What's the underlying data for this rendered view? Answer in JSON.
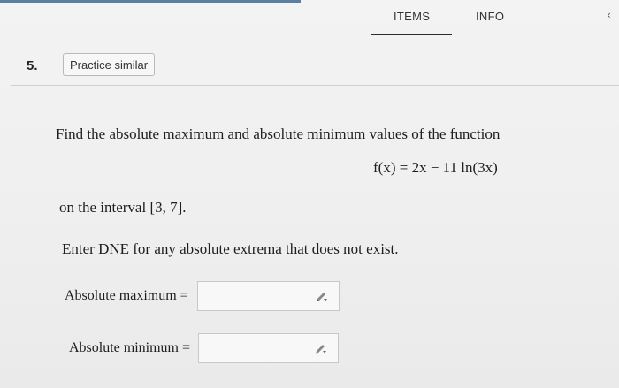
{
  "tabs": {
    "items": "ITEMS",
    "info": "INFO"
  },
  "question": {
    "number": "5.",
    "practice_label": "Practice similar",
    "prompt": "Find the absolute maximum and absolute minimum values of the function",
    "function": "f(x) = 2x − 11 ln(3x)",
    "interval_text": "on the interval [3, 7].",
    "dne_note": "Enter DNE for any absolute extrema that does not exist."
  },
  "answers": {
    "max_label": "Absolute maximum =",
    "min_label": "Absolute minimum =",
    "max_value": "",
    "min_value": ""
  },
  "icons": {
    "input_icon": "pencil-icon",
    "corner_mark": "chevron-icon"
  },
  "colors": {
    "accent_strip": "#5a7fa3"
  }
}
